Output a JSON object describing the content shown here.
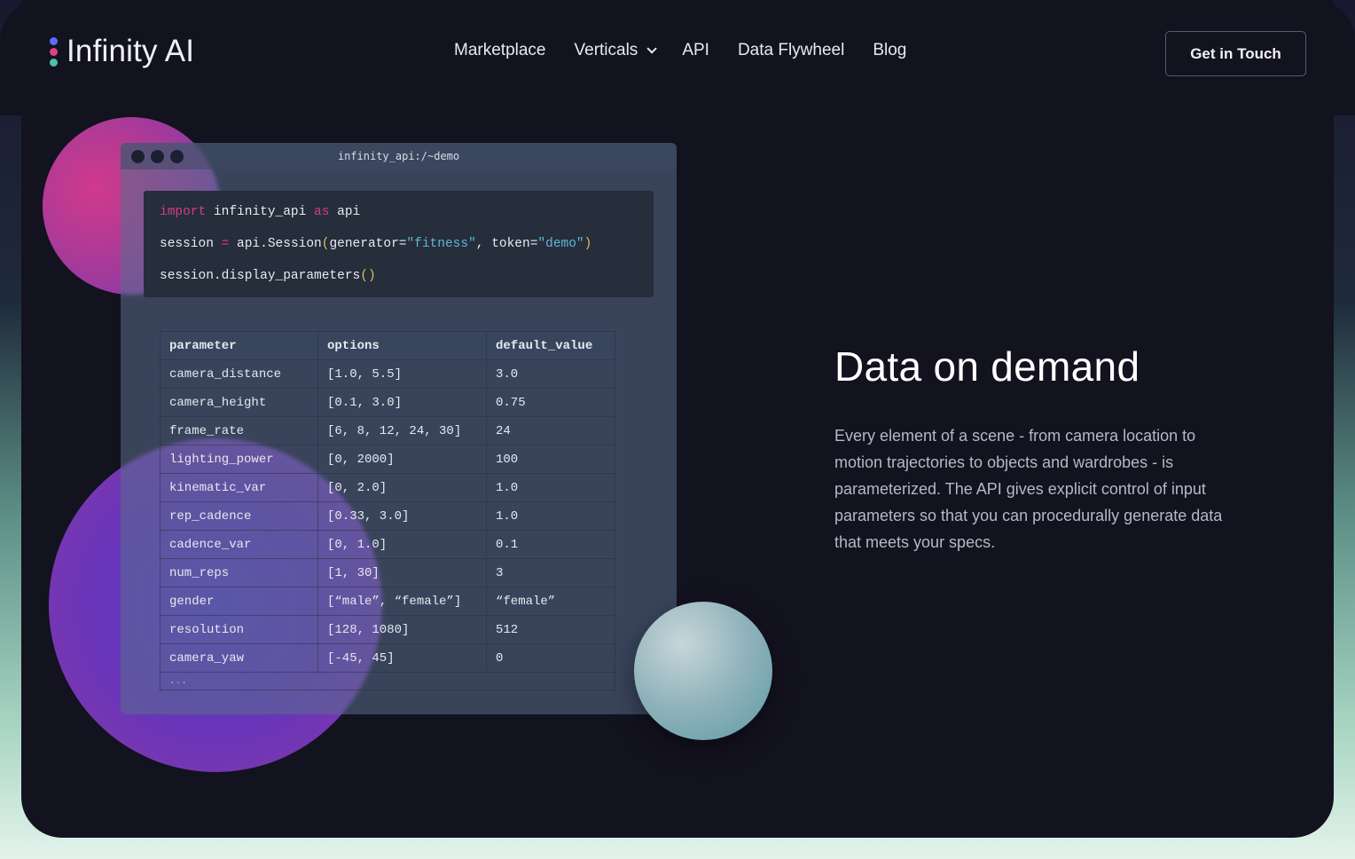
{
  "nav": {
    "logo_text": "Infinity AI",
    "logo_dot_colors": [
      "#5b6bff",
      "#e0408a",
      "#48c2b0"
    ],
    "links": [
      "Marketplace",
      "Verticals",
      "API",
      "Data Flywheel",
      "Blog"
    ],
    "cta_label": "Get in Touch"
  },
  "terminal": {
    "title": "infinity_api:/~demo",
    "code": {
      "line1": {
        "kw_import": "import",
        "mod": " infinity_api ",
        "kw_as": "as",
        "alias": " api"
      },
      "line2": {
        "lhs": "session ",
        "eq": "=",
        "call": " api.Session",
        "open": "(",
        "arg1": "generator=",
        "val1": "\"fitness\"",
        "sep": ", token=",
        "val2": "\"demo\"",
        "close": ")"
      },
      "line3": {
        "call": "session.display_parameters",
        "parens": "()"
      }
    },
    "table": {
      "headers": [
        "parameter",
        "options",
        "default_value"
      ],
      "rows": [
        [
          "camera_distance",
          "[1.0, 5.5]",
          "3.0"
        ],
        [
          "camera_height",
          "[0.1, 3.0]",
          "0.75"
        ],
        [
          "frame_rate",
          "[6, 8, 12, 24, 30]",
          "24"
        ],
        [
          "lighting_power",
          "[0, 2000]",
          "100"
        ],
        [
          "kinematic_var",
          "[0, 2.0]",
          "1.0"
        ],
        [
          "rep_cadence",
          "[0.33, 3.0]",
          "1.0"
        ],
        [
          "cadence_var",
          "[0, 1.0]",
          "0.1"
        ],
        [
          "num_reps",
          "[1, 30]",
          "3"
        ],
        [
          "gender",
          "[“male”, “female”]",
          "“female”"
        ],
        [
          "resolution",
          "[128, 1080]",
          "512"
        ],
        [
          "camera_yaw",
          "[-45, 45]",
          "0"
        ]
      ],
      "ellipsis": "..."
    }
  },
  "hero": {
    "headline": "Data on demand",
    "description": "Every element of a scene - from camera location to motion trajectories to objects and wardrobes - is parameterized. The API gives explicit control of input parameters so that you can procedurally generate data that meets your specs."
  },
  "colors": {
    "background": "#13121f",
    "accent_pink": "#d43d86",
    "accent_string": "#5fb7d6"
  }
}
